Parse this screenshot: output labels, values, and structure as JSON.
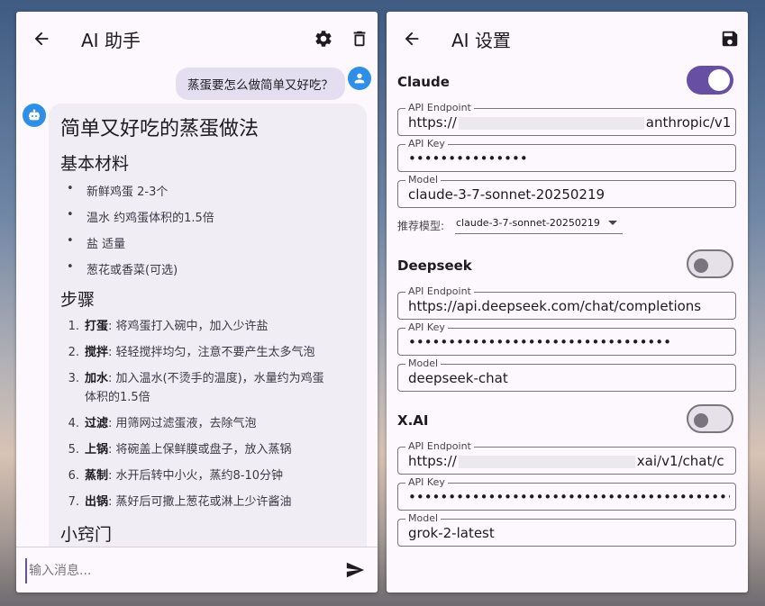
{
  "chat": {
    "title": "AI 助手",
    "user_message": "蒸蛋要怎么做简单又好吃？",
    "response": {
      "heading": "简单又好吃的蒸蛋做法",
      "materials_heading": "基本材料",
      "materials": [
        "新鲜鸡蛋 2-3个",
        "温水 约鸡蛋体积的1.5倍",
        "盐 适量",
        "葱花或香菜(可选)"
      ],
      "steps_heading": "步骤",
      "steps": [
        {
          "num": "1.",
          "title": "打蛋",
          "text": ": 将鸡蛋打入碗中，加入少许盐"
        },
        {
          "num": "2.",
          "title": "搅拌",
          "text": ": 轻轻搅拌均匀，注意不要产生太多气泡"
        },
        {
          "num": "3.",
          "title": "加水",
          "text": ": 加入温水(不烫手的温度)，水量约为鸡蛋",
          "text2": "体积的1.5倍"
        },
        {
          "num": "4.",
          "title": "过滤",
          "text": ": 用筛网过滤蛋液，去除气泡"
        },
        {
          "num": "5.",
          "title": "上锅",
          "text": ": 将碗盖上保鲜膜或盘子，放入蒸锅"
        },
        {
          "num": "6.",
          "title": "蒸制",
          "text": ": 水开后转中小火，蒸约8-10分钟"
        },
        {
          "num": "7.",
          "title": "出锅",
          "text": ": 蒸好后可撒上葱花或淋上少许酱油"
        }
      ],
      "tips_heading": "小窍门"
    },
    "input_placeholder": "输入消息..."
  },
  "settings": {
    "title": "AI 设置",
    "providers": [
      {
        "name": "Claude",
        "enabled": true,
        "endpoint_label": "API Endpoint",
        "endpoint_prefix": "https://",
        "endpoint_suffix": "anthropic/v1",
        "key_label": "API Key",
        "key_value": "•••••••••••••••",
        "model_label": "Model",
        "model_value": "claude-3-7-sonnet-20250219"
      },
      {
        "name": "Deepseek",
        "enabled": false,
        "endpoint_label": "API Endpoint",
        "endpoint_value": "https://api.deepseek.com/chat/completions",
        "key_label": "API Key",
        "key_value": "•••••••••••••••••••••••••••••••••",
        "model_label": "Model",
        "model_value": "deepseek-chat"
      },
      {
        "name": "X.AI",
        "enabled": false,
        "endpoint_label": "API Endpoint",
        "endpoint_prefix": "https://",
        "endpoint_suffix": "xai/v1/chat/c",
        "key_label": "API Key",
        "key_value": "••••••••••••••••••••••••••••••••••••••••••••••••••••••",
        "model_label": "Model",
        "model_value": "grok-2-latest"
      }
    ],
    "recommended_label": "推荐模型:",
    "recommended_value": "claude-3-7-sonnet-20250219"
  },
  "colors": {
    "accent": "#6750a4",
    "avatar_blue": "#2f8fe6",
    "user_bubble": "#e3dff1",
    "ai_bubble": "#f0edf5"
  },
  "icons": {
    "back": "arrow-left-icon",
    "settings": "gear-icon",
    "delete": "trash-icon",
    "save": "save-icon",
    "send": "send-icon"
  }
}
